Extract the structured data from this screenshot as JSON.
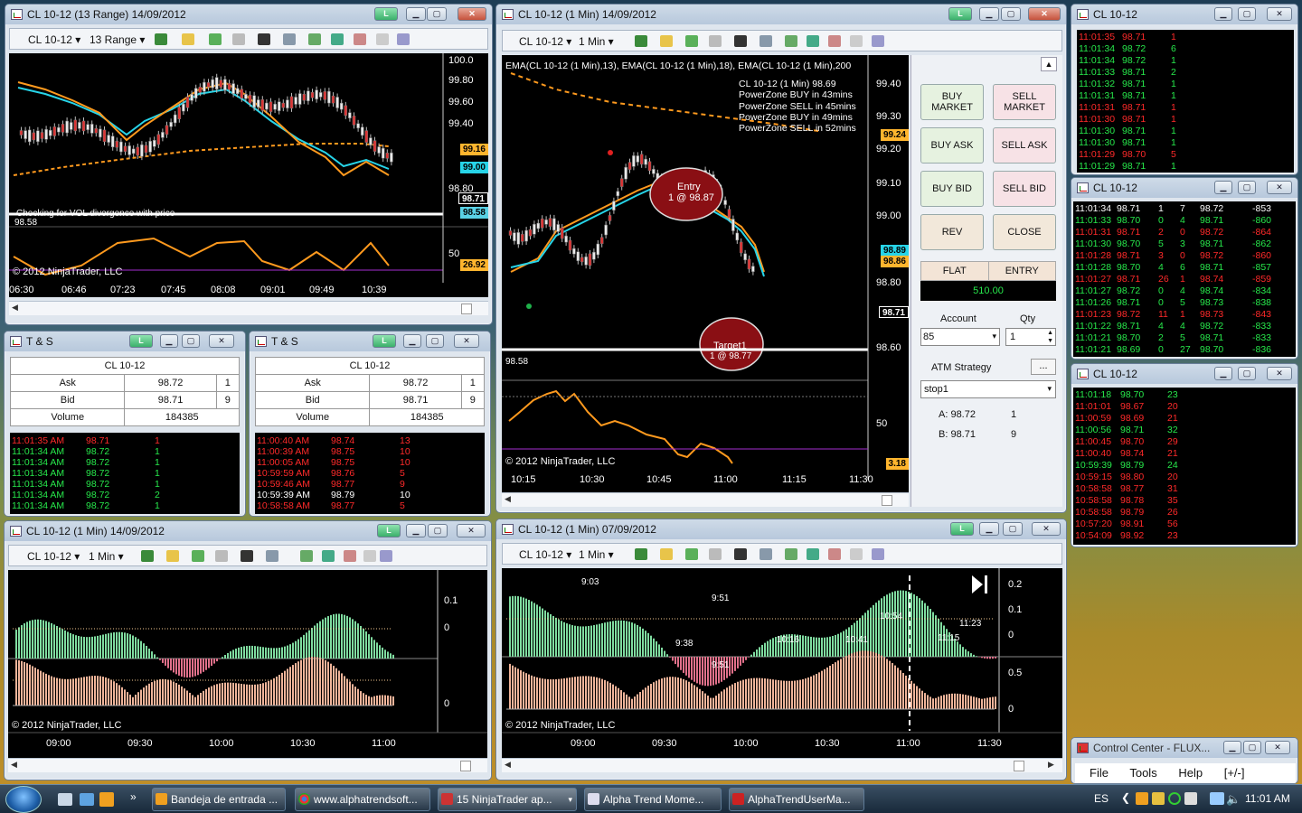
{
  "colors": {
    "green": "#27e84b",
    "red": "#ff2a2a",
    "orange": "#ff9a1e",
    "cyan": "#27d4e8",
    "chart_bg": "#000000"
  },
  "icons": {
    "window": "chart-window-icon",
    "close": "close-icon",
    "maximize": "maximize-icon",
    "minimize": "minimize-icon",
    "link": "link-L-icon"
  },
  "w1": {
    "title": "CL 10-12 (13 Range)  14/09/2012",
    "instrument": "CL 10-12",
    "interval": "13 Range",
    "prices": [
      "100.0",
      "99.80",
      "99.60",
      "99.40",
      "99.20",
      "99.00",
      "98.80"
    ],
    "lastprice": "98.71",
    "levels": [
      "99.16",
      "99.00",
      "98.58"
    ],
    "bottom_label": "98.58",
    "indicator_text": "Checking for VOL divergence with price",
    "copyright": "© 2012 NinjaTrader, LLC",
    "osc_scale": [
      "50"
    ],
    "osc_value": "26.92",
    "times": [
      "06:30",
      "06:46",
      "07:23",
      "07:45",
      "08:08",
      "09:01",
      "09:49",
      "10:39"
    ]
  },
  "w2": {
    "title": "CL 10-12 (1 Min)  14/09/2012",
    "instrument": "CL 10-12",
    "interval": "1 Min",
    "ema_label": "EMA(CL 10-12 (1 Min),13), EMA(CL 10-12 (1 Min),18), EMA(CL 10-12 (1 Min),200",
    "info": [
      "CL 10-12 (1 Min) 98.69",
      "PowerZone BUY in 43mins",
      "PowerZone SELL in 45mins",
      "PowerZone BUY in 49mins",
      "PowerZone SELL in 52mins"
    ],
    "prices": [
      "99.40",
      "99.30",
      "99.20",
      "99.10",
      "99.00",
      "98.90",
      "98.80",
      "98.60"
    ],
    "labels": [
      "99.24",
      "98.89",
      "98.86",
      "98.71"
    ],
    "bottom_label": "98.58",
    "entry": "Entry",
    "entry_qty": "1 @ 98.87",
    "target": "Target1",
    "target_qty": "1 @ 98.77",
    "osc_scale": "50",
    "osc_value": "3.18",
    "copyright": "© 2012 NinjaTrader, LLC",
    "times": [
      "10:15",
      "10:30",
      "10:45",
      "11:00",
      "11:15",
      "11:30"
    ]
  },
  "order": {
    "buy_market": "BUY MARKET",
    "sell_market": "SELL MARKET",
    "buy_ask": "BUY ASK",
    "sell_ask": "SELL ASK",
    "buy_bid": "BUY BID",
    "sell_bid": "SELL BID",
    "rev": "REV",
    "close": "CLOSE",
    "flat": "FLAT",
    "entry": "ENTRY",
    "pnl": "510.00",
    "account_label": "Account",
    "account_value": "85",
    "qty_label": "Qty",
    "qty_value": "1",
    "atm_label": "ATM Strategy",
    "atm_button": "...",
    "atm_value": "stop1",
    "ask_line": "A: 98.72",
    "ask_qty": "1",
    "bid_line": "B: 98.71",
    "bid_qty": "9"
  },
  "ts1": {
    "title": "T & S",
    "instrument": "CL 10-12",
    "ask_label": "Ask",
    "ask": "98.72",
    "ask_size": "1",
    "bid_label": "Bid",
    "bid": "98.71",
    "bid_size": "9",
    "volume_label": "Volume",
    "volume": "184385",
    "rows": [
      [
        "11:01:35 AM",
        "98.71",
        "1",
        "r"
      ],
      [
        "11:01:34 AM",
        "98.72",
        "1",
        "g"
      ],
      [
        "11:01:34 AM",
        "98.72",
        "1",
        "g"
      ],
      [
        "11:01:34 AM",
        "98.72",
        "1",
        "g"
      ],
      [
        "11:01:34 AM",
        "98.72",
        "1",
        "g"
      ],
      [
        "11:01:34 AM",
        "98.72",
        "2",
        "g"
      ],
      [
        "11:01:34 AM",
        "98.72",
        "1",
        "g"
      ]
    ]
  },
  "ts2": {
    "title": "T & S",
    "instrument": "CL 10-12",
    "ask_label": "Ask",
    "ask": "98.72",
    "ask_size": "1",
    "bid_label": "Bid",
    "bid": "98.71",
    "bid_size": "9",
    "volume_label": "Volume",
    "volume": "184385",
    "rows": [
      [
        "11:00:40 AM",
        "98.74",
        "13",
        "r"
      ],
      [
        "11:00:39 AM",
        "98.75",
        "10",
        "r"
      ],
      [
        "11:00:05 AM",
        "98.75",
        "10",
        "r"
      ],
      [
        "10:59:59 AM",
        "98.76",
        "5",
        "r"
      ],
      [
        "10:59:46 AM",
        "98.77",
        "9",
        "r"
      ],
      [
        "10:59:39 AM",
        "98.79",
        "10",
        "w"
      ],
      [
        "10:58:58 AM",
        "98.77",
        "5",
        "r"
      ]
    ]
  },
  "tick1": {
    "title": "CL 10-12",
    "rows": [
      [
        "11:01:35",
        "98.71",
        "1",
        "r"
      ],
      [
        "11:01:34",
        "98.72",
        "6",
        "g"
      ],
      [
        "11:01:34",
        "98.72",
        "1",
        "g"
      ],
      [
        "11:01:33",
        "98.71",
        "2",
        "g"
      ],
      [
        "11:01:32",
        "98.71",
        "1",
        "g"
      ],
      [
        "11:01:31",
        "98.71",
        "1",
        "g"
      ],
      [
        "11:01:31",
        "98.71",
        "1",
        "r"
      ],
      [
        "11:01:30",
        "98.71",
        "1",
        "r"
      ],
      [
        "11:01:30",
        "98.71",
        "1",
        "g"
      ],
      [
        "11:01:30",
        "98.71",
        "1",
        "g"
      ],
      [
        "11:01:29",
        "98.70",
        "5",
        "r"
      ],
      [
        "11:01:29",
        "98.71",
        "1",
        "g"
      ]
    ]
  },
  "tick2": {
    "title": "CL 10-12",
    "rows": [
      [
        "11:01:34",
        "98.71",
        "1",
        "7",
        "98.72",
        "-853",
        "w"
      ],
      [
        "11:01:33",
        "98.70",
        "0",
        "4",
        "98.71",
        "-860",
        "g"
      ],
      [
        "11:01:31",
        "98.71",
        "2",
        "0",
        "98.72",
        "-864",
        "r"
      ],
      [
        "11:01:30",
        "98.70",
        "5",
        "3",
        "98.71",
        "-862",
        "g"
      ],
      [
        "11:01:28",
        "98.71",
        "3",
        "0",
        "98.72",
        "-860",
        "r"
      ],
      [
        "11:01:28",
        "98.70",
        "4",
        "6",
        "98.71",
        "-857",
        "g"
      ],
      [
        "11:01:27",
        "98.71",
        "26",
        "1",
        "98.74",
        "-859",
        "r"
      ],
      [
        "11:01:27",
        "98.72",
        "0",
        "4",
        "98.74",
        "-834",
        "g"
      ],
      [
        "11:01:26",
        "98.71",
        "0",
        "5",
        "98.73",
        "-838",
        "g"
      ],
      [
        "11:01:23",
        "98.72",
        "11",
        "1",
        "98.73",
        "-843",
        "r"
      ],
      [
        "11:01:22",
        "98.71",
        "4",
        "4",
        "98.72",
        "-833",
        "g"
      ],
      [
        "11:01:21",
        "98.70",
        "2",
        "5",
        "98.71",
        "-833",
        "g"
      ],
      [
        "11:01:21",
        "98.69",
        "0",
        "27",
        "98.70",
        "-836",
        "g"
      ]
    ]
  },
  "tick3": {
    "title": "CL 10-12",
    "rows": [
      [
        "11:01:18",
        "98.70",
        "23",
        "g"
      ],
      [
        "11:01:01",
        "98.67",
        "20",
        "r"
      ],
      [
        "11:00:59",
        "98.69",
        "21",
        "r"
      ],
      [
        "11:00:56",
        "98.71",
        "32",
        "g"
      ],
      [
        "11:00:45",
        "98.70",
        "29",
        "r"
      ],
      [
        "11:00:40",
        "98.74",
        "21",
        "r"
      ],
      [
        "10:59:39",
        "98.79",
        "24",
        "g"
      ],
      [
        "10:59:15",
        "98.80",
        "20",
        "r"
      ],
      [
        "10:58:58",
        "98.77",
        "31",
        "r"
      ],
      [
        "10:58:58",
        "98.78",
        "35",
        "r"
      ],
      [
        "10:58:58",
        "98.79",
        "26",
        "r"
      ],
      [
        "10:57:20",
        "98.91",
        "56",
        "r"
      ],
      [
        "10:54:09",
        "98.92",
        "23",
        "r"
      ]
    ]
  },
  "w3": {
    "title": "CL 10-12 (1 Min)  14/09/2012",
    "instrument": "CL 10-12",
    "interval": "1 Min",
    "scale_top": "0.1",
    "scale_zero": "0",
    "scale_zero2": "0",
    "copyright": "© 2012 NinjaTrader, LLC",
    "times": [
      "09:00",
      "09:30",
      "10:00",
      "10:30",
      "11:00"
    ]
  },
  "w4": {
    "title": "CL 10-12 (1 Min)  07/09/2012",
    "instrument": "CL 10-12",
    "interval": "1 Min",
    "scale": [
      "0.2",
      "0.1",
      "0",
      "0.5",
      "0"
    ],
    "peak_labels": [
      "9:03",
      "9:51",
      "9:38",
      "10:16",
      "10:41",
      "10:54",
      "11:15",
      "11:23",
      "9:51"
    ],
    "copyright": "© 2012 NinjaTrader, LLC",
    "times": [
      "09:00",
      "09:30",
      "10:00",
      "10:30",
      "11:00",
      "11:30"
    ]
  },
  "control": {
    "title": "Control Center - FLUX...",
    "menu": [
      "File",
      "Tools",
      "Help",
      "[+/-]"
    ]
  },
  "taskbar": {
    "items": [
      "Bandeja de entrada ...",
      "www.alphatrendsoft...",
      "15 NinjaTrader ap...",
      "Alpha Trend Mome...",
      "AlphaTrendUserMa..."
    ],
    "lang": "ES",
    "clock": "11:01 AM"
  }
}
